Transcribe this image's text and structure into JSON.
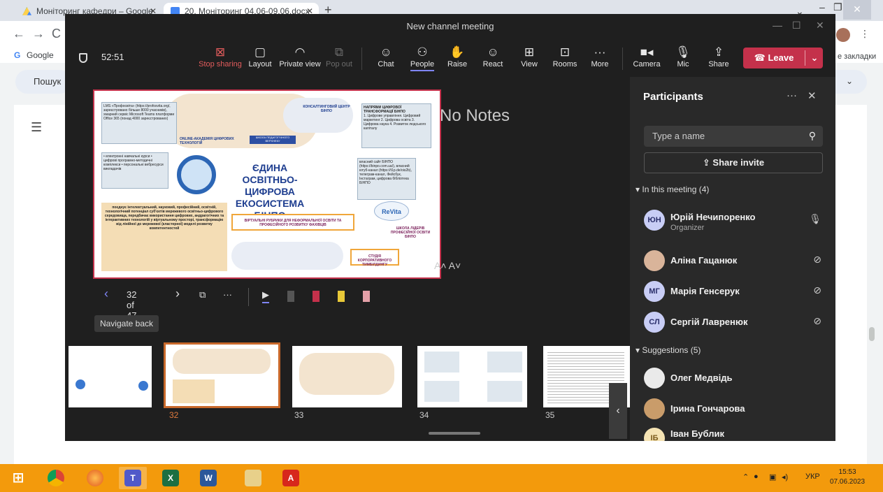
{
  "browser": {
    "tabs": [
      {
        "label": "Моніторинг кафедри – Google"
      },
      {
        "label": "20. Моніторинг 04.06-09.06.docx"
      }
    ],
    "bookmark_google": "Google",
    "bookmark_right": "е закладки",
    "docs_search": "Пошук"
  },
  "teams": {
    "window_title": "New channel meeting",
    "timer": "52:51",
    "toolbar": {
      "stop_sharing": "Stop sharing",
      "layout": "Layout",
      "private_view": "Private view",
      "pop_out": "Pop out",
      "chat": "Chat",
      "people": "People",
      "raise": "Raise",
      "react": "React",
      "view": "View",
      "rooms": "Rooms",
      "more": "More",
      "camera": "Camera",
      "mic": "Mic",
      "share": "Share",
      "leave": "Leave"
    },
    "stage": {
      "no_notes": "No Notes",
      "font_controls": "A˄  A˅",
      "slide_counter": "32 of 47",
      "tooltip": "Navigate back",
      "thumb_numbers": [
        "32",
        "33",
        "34",
        "35"
      ]
    },
    "slide": {
      "title": "ЄДИНА ОСВІТНЬО-ЦИФРОВА ЕКОСИСТЕМА БІНПО",
      "online_academy": "ONLINE-АКАДЕМІЯ ЦИФРОВИХ ТЕХНОЛОГІЙ",
      "consult_center": "КОНСАЛТИНГОВИЙ ЦЕНТР БІНПО",
      "school": "ШКОЛА ПЕДАГОГІЧНОГО ВЕРХНЕКУ",
      "lms": "LMS «Профосвіта» (https://profosvita.org/, зареєстровано більше 8000 учасників), хмарний сервіс Microsoft Teams платформи Office 365 (понад 4000 зареєстрованих)",
      "directions_title": "НАПРЯМИ ЦИФРОВОЇ ТРАНСФОРМАЦІЇ БІНПО",
      "directions": "1. Цифрове управління. Цифровий маркетинг 2. Цифрова освіта 3. Цифрова наука 4. Розвиток людського капіталу",
      "courses": "• електронні навчальні курси • цифрові програмно-методичні комплекси • персональні вебресурси викладачів",
      "site": "власний сайт БІНПО (https://binpo.com.ua/), власний ютуб-канал (https://t1p.de/ois2b), телеграм-канал, Фейсбук, Інстаграм, цифрова бібліотека БІНПО",
      "virtual": "ВІРТУАЛЬНІ РУБРИКИ ДЛЯ НЕФОРМАЛЬНОЇ ОСВІТИ ТА ПРОФЕСІЙНОГО РОЗВИТКУ ФАХІВЦІВ",
      "leaders": "ШКОЛА ЛІДЕРІВ ПРОФЕСІЙНОЇ ОСВІТИ БІНПО",
      "studio": "СТУДІЯ КОРПОРАТИВНОГО ТИМБІЛДИНГУ",
      "revita": "ReVita",
      "bottom": "поєднує інтелектуальний, науковий, професійний, освітній, технологічний потенціал суб'єктів мережевого освітньо-цифрового середовища, передбачає використання цифрових, андрагогічних та інтерактивних технологій у віртуальному просторі, трансформацію від лінійної до мережевої (кластерної) моделі розвитку компетентностей"
    },
    "participants": {
      "header": "Participants",
      "search_placeholder": "Type a name",
      "share_invite": "Share invite",
      "in_meeting_label": "In this meeting (4)",
      "in_meeting": [
        {
          "initials": "ЮН",
          "name": "Юрій Нечипоренко",
          "role": "Organizer",
          "color": "#c8cdf5"
        },
        {
          "initials": "",
          "name": "Аліна Гацанюк",
          "role": "",
          "color": "#d9b49a"
        },
        {
          "initials": "МГ",
          "name": "Марія Генсерук",
          "role": "",
          "color": "#c8cdf5"
        },
        {
          "initials": "СЛ",
          "name": "Сергій Лавренюк",
          "role": "",
          "color": "#c8cdf5"
        }
      ],
      "suggestions_label": "Suggestions (5)",
      "suggestions": [
        {
          "initials": "",
          "name": "Олег Медвідь",
          "color": "#eaeaea"
        },
        {
          "initials": "",
          "name": "Ірина Гончарова",
          "color": "#c99c6a"
        },
        {
          "initials": "ІБ",
          "name": "Іван Бублик",
          "color": "#f5e3b3"
        }
      ]
    }
  },
  "taskbar": {
    "lang": "УКР",
    "time": "15:53",
    "date": "07.06.2023"
  }
}
